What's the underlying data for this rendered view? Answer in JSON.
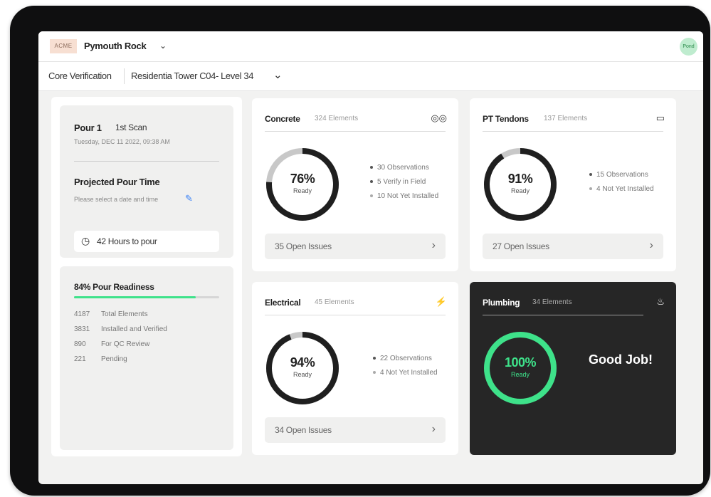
{
  "header": {
    "logo_text": "ACME",
    "project_name": "Pymouth Rock",
    "avatar_initials": "Pond"
  },
  "subheader": {
    "section": "Core Verification",
    "location": "Residentia Tower C04- Level 34"
  },
  "pour": {
    "title": "Pour 1",
    "scan": "1st Scan",
    "date": "Tuesday, DEC 11 2022, 09:38 AM",
    "projected_title": "Projected Pour Time",
    "projected_hint": "Please select a date and time",
    "hours_to_pour": "42 Hours to pour"
  },
  "readiness": {
    "title": "84% Pour Readiness",
    "progress": 0.84,
    "items": [
      {
        "value": "4187",
        "label": "Total Elements"
      },
      {
        "value": "3831",
        "label": "Installed and Verified"
      },
      {
        "value": "890",
        "label": "For QC Review"
      },
      {
        "value": "221",
        "label": "Pending"
      }
    ]
  },
  "cards": {
    "concrete": {
      "title": "Concrete",
      "count": "324 Elements",
      "icon": "concrete-icon",
      "icon_glyph": "◎◎",
      "percent": 76,
      "pct_label": "76%",
      "ready": "Ready",
      "stats": [
        "30 Observations",
        "5 Verify in Field",
        "10 Not Yet Installed"
      ],
      "issues": "35 Open Issues"
    },
    "pt_tendons": {
      "title": "PT Tendons",
      "count": "137 Elements",
      "icon": "tendon-icon",
      "icon_glyph": "▭",
      "percent": 91,
      "pct_label": "91%",
      "ready": "Ready",
      "stats": [
        "15 Observations",
        "4 Not Yet Installed"
      ],
      "issues": "27 Open Issues"
    },
    "electrical": {
      "title": "Electrical",
      "count": "45 Elements",
      "icon": "electrical-icon",
      "icon_glyph": "⚡",
      "percent": 94,
      "pct_label": "94%",
      "ready": "Ready",
      "stats": [
        "22 Observations",
        "4 Not Yet Installed"
      ],
      "issues": "34 Open Issues"
    },
    "plumbing": {
      "title": "Plumbing",
      "count": "34 Elements",
      "icon": "plumbing-icon",
      "icon_glyph": "♨",
      "percent": 100,
      "pct_label": "100%",
      "ready": "Ready",
      "good_job": "Good Job!"
    }
  },
  "colors": {
    "accent_green": "#3ee28a",
    "ring_dark": "#1f1f1f",
    "ring_track": "#c8c8c8",
    "edit_blue": "#3b82f6",
    "dark_card": "#262626"
  }
}
